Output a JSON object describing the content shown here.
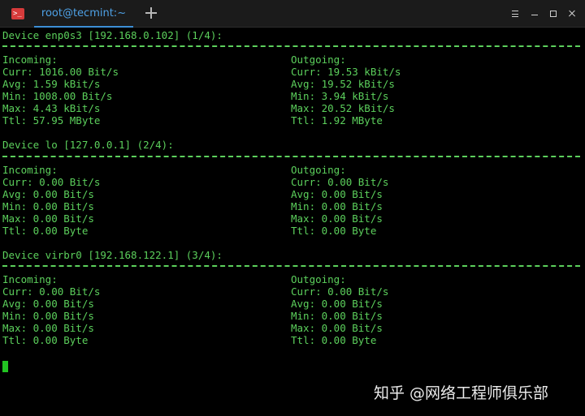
{
  "app": {
    "tab_title": "root@tecmint:~",
    "app_icon_glyph": ">_"
  },
  "colors": {
    "terminal_text": "#5cd05c",
    "background": "#000000",
    "tab_accent": "#3d8fd6"
  },
  "devices": [
    {
      "header": "Device enp0s3 [192.168.0.102] (1/4):",
      "incoming": {
        "title": "Incoming:",
        "curr": "Curr: 1016.00 Bit/s",
        "avg": "Avg: 1.59 kBit/s",
        "min": "Min: 1008.00 Bit/s",
        "max": "Max: 4.43 kBit/s",
        "ttl": "Ttl: 57.95 MByte"
      },
      "outgoing": {
        "title": "Outgoing:",
        "curr": "Curr: 19.53 kBit/s",
        "avg": "Avg: 19.52 kBit/s",
        "min": "Min: 3.94 kBit/s",
        "max": "Max: 20.52 kBit/s",
        "ttl": "Ttl: 1.92 MByte"
      }
    },
    {
      "header": "Device lo [127.0.0.1] (2/4):",
      "incoming": {
        "title": "Incoming:",
        "curr": "Curr: 0.00 Bit/s",
        "avg": "Avg: 0.00 Bit/s",
        "min": "Min: 0.00 Bit/s",
        "max": "Max: 0.00 Bit/s",
        "ttl": "Ttl: 0.00 Byte"
      },
      "outgoing": {
        "title": "Outgoing:",
        "curr": "Curr: 0.00 Bit/s",
        "avg": "Avg: 0.00 Bit/s",
        "min": "Min: 0.00 Bit/s",
        "max": "Max: 0.00 Bit/s",
        "ttl": "Ttl: 0.00 Byte"
      }
    },
    {
      "header": "Device virbr0 [192.168.122.1] (3/4):",
      "incoming": {
        "title": "Incoming:",
        "curr": "Curr: 0.00 Bit/s",
        "avg": "Avg: 0.00 Bit/s",
        "min": "Min: 0.00 Bit/s",
        "max": "Max: 0.00 Bit/s",
        "ttl": "Ttl: 0.00 Byte"
      },
      "outgoing": {
        "title": "Outgoing:",
        "curr": "Curr: 0.00 Bit/s",
        "avg": "Avg: 0.00 Bit/s",
        "min": "Min: 0.00 Bit/s",
        "max": "Max: 0.00 Bit/s",
        "ttl": "Ttl: 0.00 Byte"
      }
    }
  ],
  "watermark": "知乎 @网络工程师俱乐部"
}
